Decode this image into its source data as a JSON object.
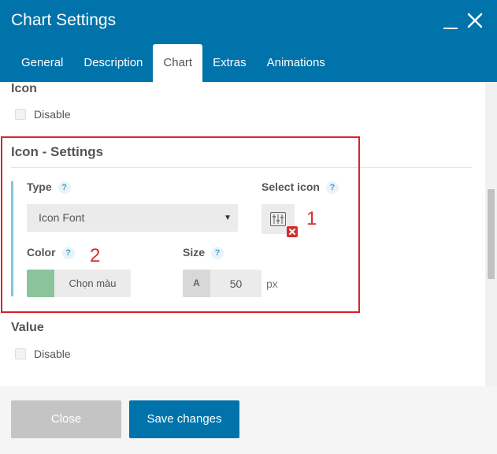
{
  "window": {
    "title": "Chart Settings"
  },
  "tabs": [
    {
      "label": "General"
    },
    {
      "label": "Description"
    },
    {
      "label": "Chart",
      "active": true
    },
    {
      "label": "Extras"
    },
    {
      "label": "Animations"
    }
  ],
  "content": {
    "icon_section": {
      "label": "Icon",
      "checkbox_label": "Disable",
      "checked": false
    },
    "icon_settings": {
      "title": "Icon - Settings",
      "type": {
        "label": "Type",
        "help": "?",
        "value": "Icon Font"
      },
      "select_icon": {
        "label": "Select icon",
        "help": "?"
      },
      "color": {
        "label": "Color",
        "help": "?",
        "button_label": "Chọn màu",
        "swatch_color": "#8bc49b"
      },
      "size": {
        "label": "Size",
        "help": "?",
        "prefix": "A",
        "value": "50",
        "unit": "px"
      }
    },
    "value_section": {
      "label": "Value",
      "checkbox_label": "Disable",
      "checked": false
    },
    "annotations": {
      "one": "1",
      "two": "2"
    }
  },
  "footer": {
    "close_label": "Close",
    "save_label": "Save changes"
  },
  "colors": {
    "primary": "#0073aa",
    "annotation": "#d9222a",
    "accent_bar": "#7ec8da"
  }
}
